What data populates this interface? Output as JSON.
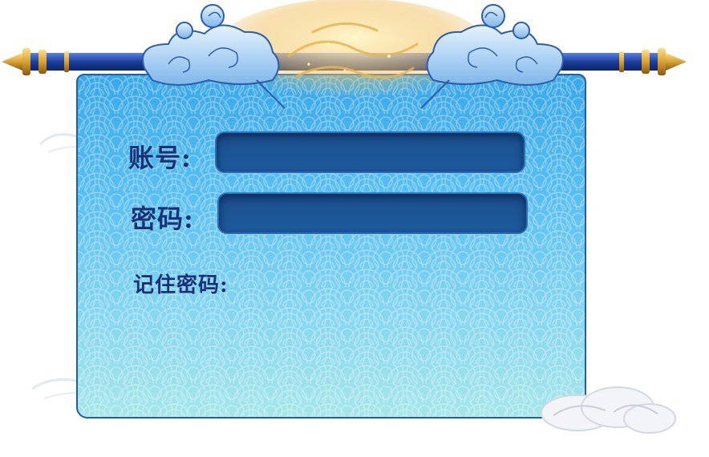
{
  "form": {
    "account_label": "账号:",
    "account_value": "",
    "password_label": "密码:",
    "password_value": "",
    "remember_label": "记住密码:"
  },
  "colors": {
    "label_text": "#16337a",
    "input_fill": "#1b4f8e",
    "paper_top": "#3aa8e8",
    "paper_bottom": "#a6e6ea",
    "rod_blue": "#1c3f9c",
    "rod_gold": "#d9a233"
  },
  "icons": {
    "left_rod_cap": "gold-spear-cap-icon",
    "right_rod_cap": "gold-spear-cap-icon",
    "top_ornament": "auspicious-cloud-ornament-icon"
  }
}
